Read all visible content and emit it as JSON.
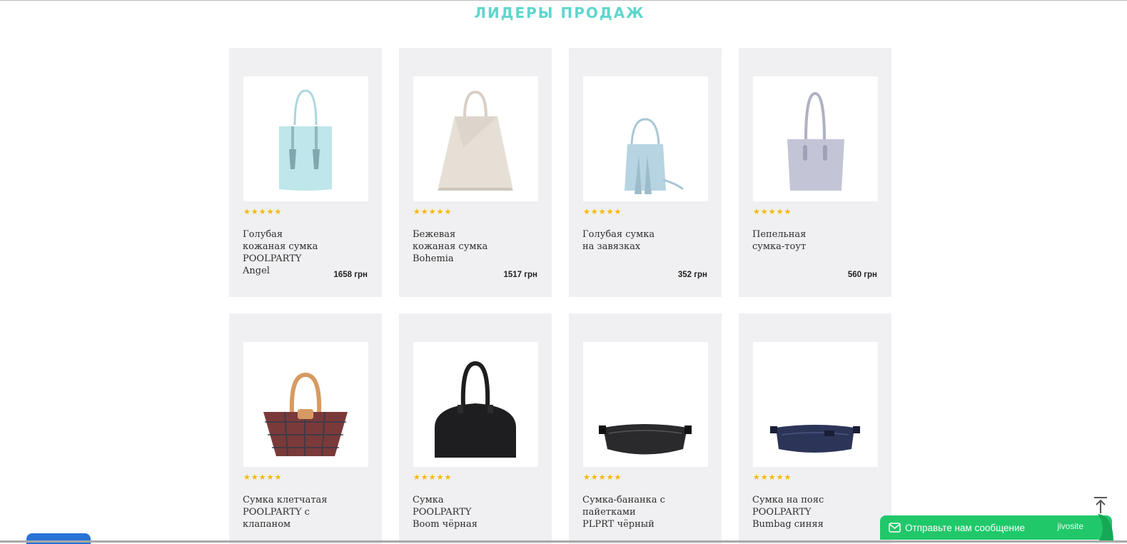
{
  "section": {
    "title": "ЛИДЕРЫ ПРОДАЖ"
  },
  "products": [
    {
      "name": "Голубая кожаная сумка POOLPARTY Angel",
      "price": "1658 грн",
      "stars": "★★★★★",
      "rating": 5,
      "color": "#bfe6ea"
    },
    {
      "name": "Бежевая кожаная сумка Bohemia",
      "price": "1517 грн",
      "stars": "★★★★★",
      "rating": 5,
      "color": "#e6dfd6"
    },
    {
      "name": "Голубая сумка на завязках",
      "price": "352 грн",
      "stars": "★★★★★",
      "rating": 5,
      "color": "#b6d4e2"
    },
    {
      "name": "Пепельная сумка-тоут",
      "price": "560 грн",
      "stars": "★★★★★",
      "rating": 5,
      "color": "#c3c5d6"
    },
    {
      "name": "Сумка клетчатая POOLPARTY с клапаном",
      "price": "",
      "stars": "★★★★★",
      "rating": 5,
      "color": "#7a3a3a"
    },
    {
      "name": "Сумка POOLPARTY Boom чёрная",
      "price": "",
      "stars": "★★★★★",
      "rating": 5,
      "color": "#1e1e20"
    },
    {
      "name": "Сумка-бананка с пайетками PLPRT чёрный",
      "price": "",
      "stars": "★★★★★",
      "rating": 5,
      "color": "#2a2a2c"
    },
    {
      "name": "Сумка на пояс POOLPARTY Bumbag синяя",
      "price": "",
      "stars": "★★★★★",
      "rating": 5,
      "color": "#2c3558"
    }
  ],
  "chat": {
    "label": "Отправьте нам сообщение",
    "brand": "jivosite",
    "icon": "mail-icon",
    "color": "#20c86a"
  },
  "scroll_top": {
    "icon": "arrow-up-bar-icon"
  },
  "colors": {
    "accent": "#5fd6cc",
    "stars": "#f5b800",
    "card": "#f0f0f2"
  }
}
